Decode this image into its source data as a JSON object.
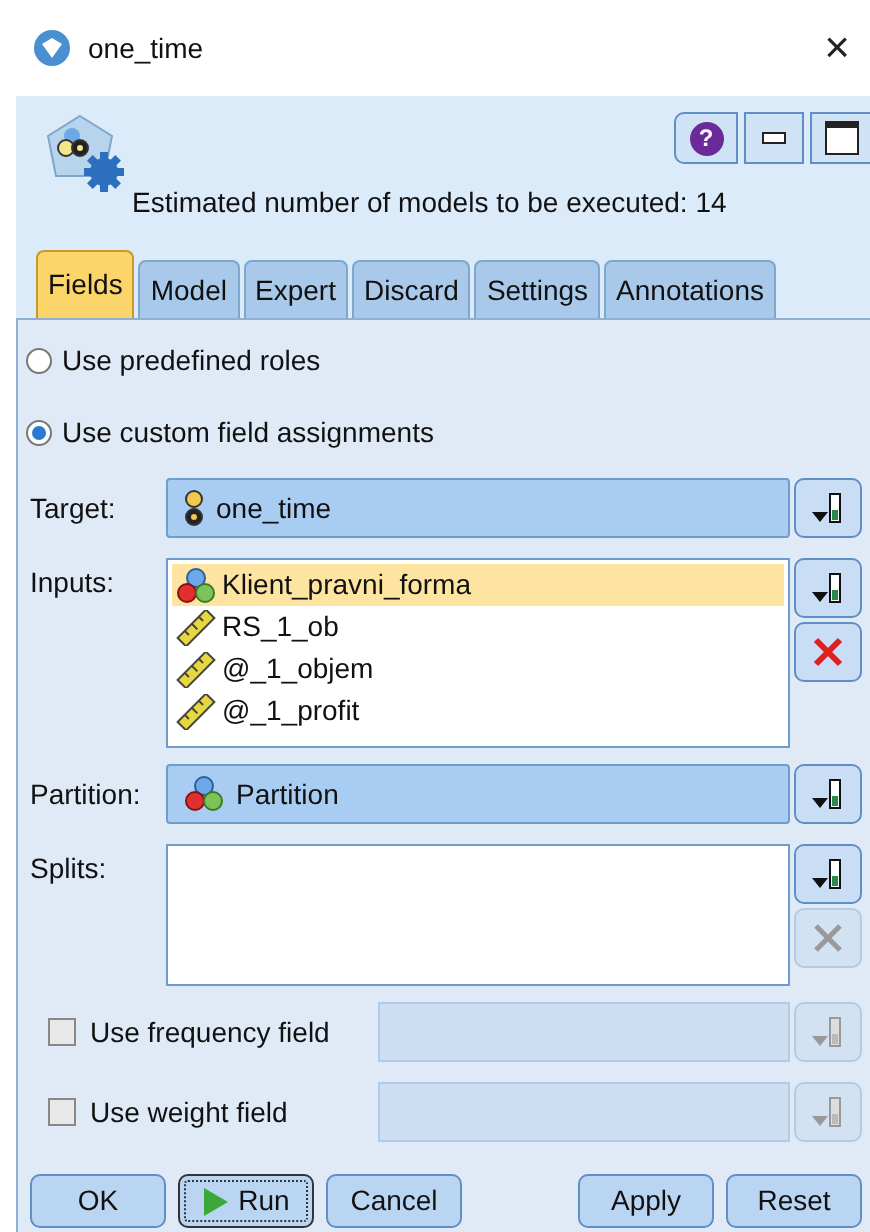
{
  "window": {
    "title": "one_time",
    "close": "×"
  },
  "header": {
    "message": "Estimated number of models to be executed: 14",
    "help": "?"
  },
  "tabs": [
    {
      "label": "Fields",
      "selected": true
    },
    {
      "label": "Model",
      "selected": false
    },
    {
      "label": "Expert",
      "selected": false
    },
    {
      "label": "Discard",
      "selected": false
    },
    {
      "label": "Settings",
      "selected": false
    },
    {
      "label": "Annotations",
      "selected": false
    }
  ],
  "role_options": [
    {
      "label": "Use predefined roles",
      "selected": false
    },
    {
      "label": "Use custom field assignments",
      "selected": true
    }
  ],
  "target": {
    "label": "Target:",
    "value": "one_time",
    "kind": "flag"
  },
  "inputs": {
    "label": "Inputs:",
    "items": [
      {
        "name": "Klient_pravni_forma",
        "kind": "nominal",
        "selected": true
      },
      {
        "name": "RS_1_ob",
        "kind": "continuous",
        "selected": false
      },
      {
        "name": "@_1_objem",
        "kind": "continuous",
        "selected": false
      },
      {
        "name": "@_1_profit",
        "kind": "continuous",
        "selected": false
      }
    ]
  },
  "partition": {
    "label": "Partition:",
    "value": "Partition",
    "kind": "nominal"
  },
  "splits": {
    "label": "Splits:"
  },
  "options": [
    {
      "label": "Use frequency field",
      "checked": false
    },
    {
      "label": "Use weight field",
      "checked": false
    }
  ],
  "buttons": [
    {
      "label": "OK",
      "kind": "plain"
    },
    {
      "label": "Run",
      "kind": "run"
    },
    {
      "label": "Cancel",
      "kind": "plain"
    },
    {
      "label": "Apply",
      "kind": "spacer"
    },
    {
      "label": "Reset",
      "kind": "plain"
    }
  ]
}
